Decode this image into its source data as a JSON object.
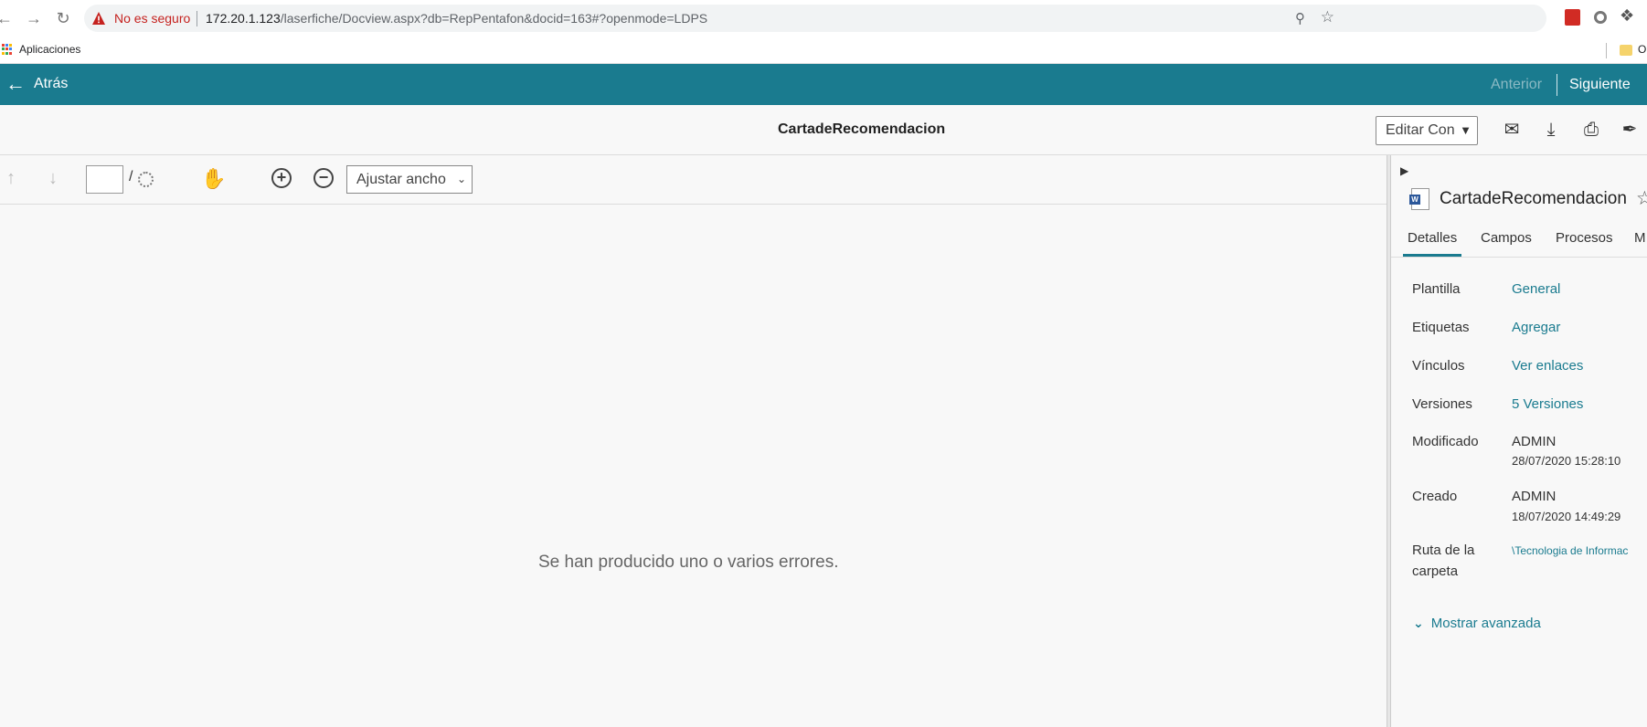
{
  "browser": {
    "security_label": "No es seguro",
    "url_host": "172.20.1.123",
    "url_path": "/laserfiche/Docview.aspx?db=RepPentafon&docid=163#?openmode=LDPS",
    "bookmarks": [
      {
        "label": "Aplicaciones"
      },
      {
        "label": "O"
      }
    ]
  },
  "header": {
    "back_label": "Atrás",
    "prev_label": "Anterior",
    "next_label": "Siguiente"
  },
  "titlebar": {
    "document_title": "CartadeRecomendacion",
    "edit_select_value": "Editar Con"
  },
  "viewer_toolbar": {
    "page_value": "",
    "page_separator": "/",
    "zoom_value": "Ajustar ancho"
  },
  "document": {
    "error_message": "Se han producido uno o varios errores."
  },
  "side_panel": {
    "title": "CartadeRecomendacion",
    "tabs": [
      {
        "label": "Detalles"
      },
      {
        "label": "Campos"
      },
      {
        "label": "Procesos"
      },
      {
        "label": "M"
      }
    ],
    "properties": {
      "plantilla": {
        "label": "Plantilla",
        "value": "General"
      },
      "etiquetas": {
        "label": "Etiquetas",
        "value": "Agregar"
      },
      "vinculos": {
        "label": "Vínculos",
        "value": "Ver enlaces"
      },
      "versiones": {
        "label": "Versiones",
        "value": "5 Versiones"
      },
      "modificado": {
        "label": "Modificado",
        "user": "ADMIN",
        "date": "28/07/2020 15:28:10"
      },
      "creado": {
        "label": "Creado",
        "user": "ADMIN",
        "date": "18/07/2020 14:49:29"
      },
      "ruta": {
        "label_line1": "Ruta de la",
        "label_line2": "carpeta",
        "value": "\\Tecnologia de Informac"
      }
    },
    "advanced_label": "Mostrar avanzada"
  },
  "colors": {
    "header_bg": "#1a7b8f",
    "link": "#1a7b8f",
    "warning": "#c5221f"
  }
}
